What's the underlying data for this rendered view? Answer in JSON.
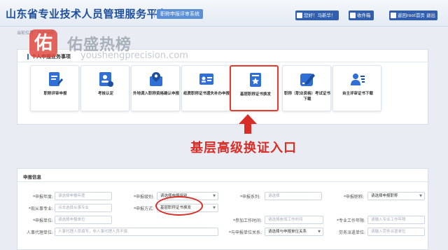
{
  "header": {
    "title": "山东省专业技术人员管理服务平台",
    "system_badge": "职称申报评审系统",
    "user_button": "您好！马新华！",
    "mail_button": "收件箱",
    "home_button": "返回root首页",
    "exit_button": "退出"
  },
  "breadcrumb": "当前位置：职称申报",
  "watermark": {
    "logo_char": "佑",
    "text": "佑盛热榜",
    "url": "youshengprecision.com"
  },
  "business": {
    "title": "个人申报业务事项",
    "items": [
      {
        "label": "职称评审申报",
        "icon": "form-edit-icon"
      },
      {
        "label": "考核认定",
        "icon": "person-check-icon"
      },
      {
        "label": "外地调入职称资格确认申报",
        "icon": "location-doc-icon"
      },
      {
        "label": "纸质职称证书遗失补办申报",
        "icon": "id-card-icon"
      },
      {
        "label": "基层职称证书换发",
        "icon": "certificate-star-icon"
      },
      {
        "label": "职称（职业资格）考试证书下载",
        "icon": "pen-edit-icon"
      },
      {
        "label": "自主评审证书下载",
        "icon": "person-list-icon"
      }
    ]
  },
  "annotation": "基层高级换证入口",
  "form": {
    "title": "申报信息",
    "fields": [
      {
        "label": "*申报年度:",
        "placeholder": "请选择申报年度"
      },
      {
        "label": "*申报级别:",
        "value": "请选择申报级别"
      },
      {
        "label": "*申报系列:",
        "placeholder": "请选择"
      },
      {
        "label": "*申报职称:",
        "value": "请选择申报职称"
      },
      {
        "label": "*现从事专业:",
        "placeholder": "点击选择从事专业"
      },
      {
        "label": "*申报方式:",
        "value": "基层职称证书换发"
      },
      {
        "label": "*申报单位:",
        "placeholder": "请选择申报单位"
      },
      {
        "label": "*参加工作时间:",
        "placeholder": "请选择参加工作时间"
      },
      {
        "label": "*专业工作年限:",
        "placeholder": "请输入专业工作年限"
      },
      {
        "label": "人事代理单位:",
        "placeholder": "人事代理人员填写，非人事代理人员不填"
      },
      {
        "label": "*与申报单位关系:",
        "value": "请选择与申报单位关系"
      },
      {
        "label": "劳务派遣单位:",
        "placeholder": "请输入劳务派遣单位"
      }
    ]
  },
  "colors": {
    "brand_blue": "#1f4f9a",
    "accent_red": "#d92d27",
    "tile_icon_blue": "#2f6fd6"
  }
}
